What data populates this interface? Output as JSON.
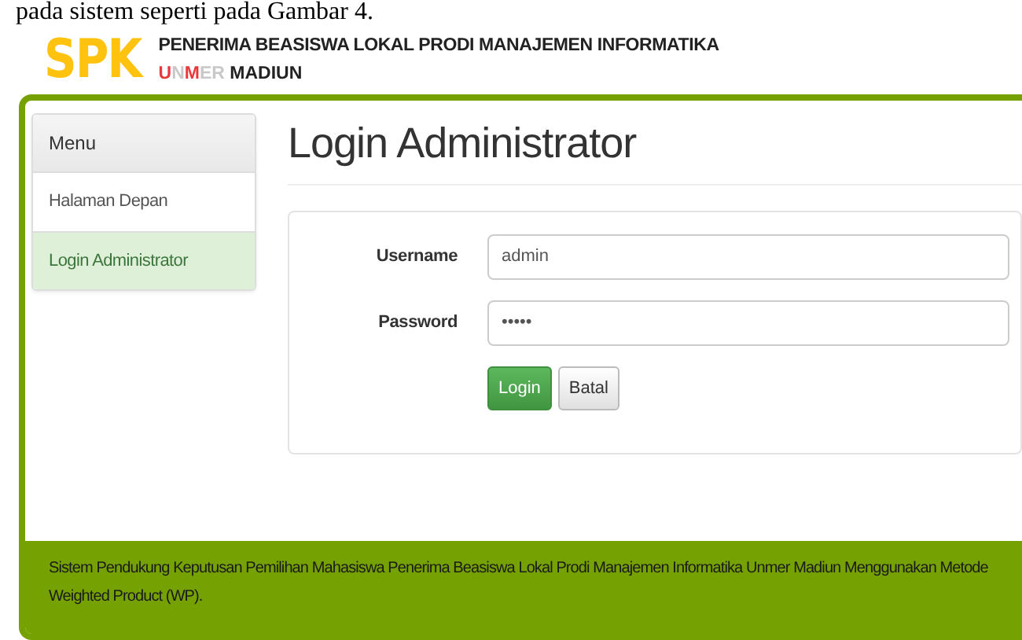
{
  "document_text": "pada sistem seperti pada Gambar 4.",
  "header": {
    "logo": "SPK",
    "title": "PENERIMA BEASISWA LOKAL PRODI MANAJEMEN INFORMATIKA",
    "subtitle_segments": [
      {
        "text": "U",
        "color": "#e8383d"
      },
      {
        "text": "N",
        "color": "#c8c8c8"
      },
      {
        "text": "M",
        "color": "#e8383d"
      },
      {
        "text": "ER",
        "color": "#c8c8c8"
      },
      {
        "text": " MADIUN",
        "color": "#222222"
      }
    ]
  },
  "sidebar": {
    "heading": "Menu",
    "items": [
      {
        "label": "Halaman Depan",
        "selected": false
      },
      {
        "label": "Login Administrator",
        "selected": true
      }
    ]
  },
  "page_title": "Login Administrator",
  "form": {
    "fields": [
      {
        "label": "Username",
        "value": "admin"
      },
      {
        "label": "Password",
        "value": "•••••"
      }
    ],
    "buttons": [
      {
        "label": "Login",
        "kind": "primary"
      },
      {
        "label": "Batal",
        "kind": "secondary"
      }
    ]
  },
  "footer": "Sistem Pendukung Keputusan Pemilihan Mahasiswa Penerima Beasiswa Lokal Prodi Manajemen Informatika Unmer Madiun Menggunakan Metode Weighted Product (WP)."
}
